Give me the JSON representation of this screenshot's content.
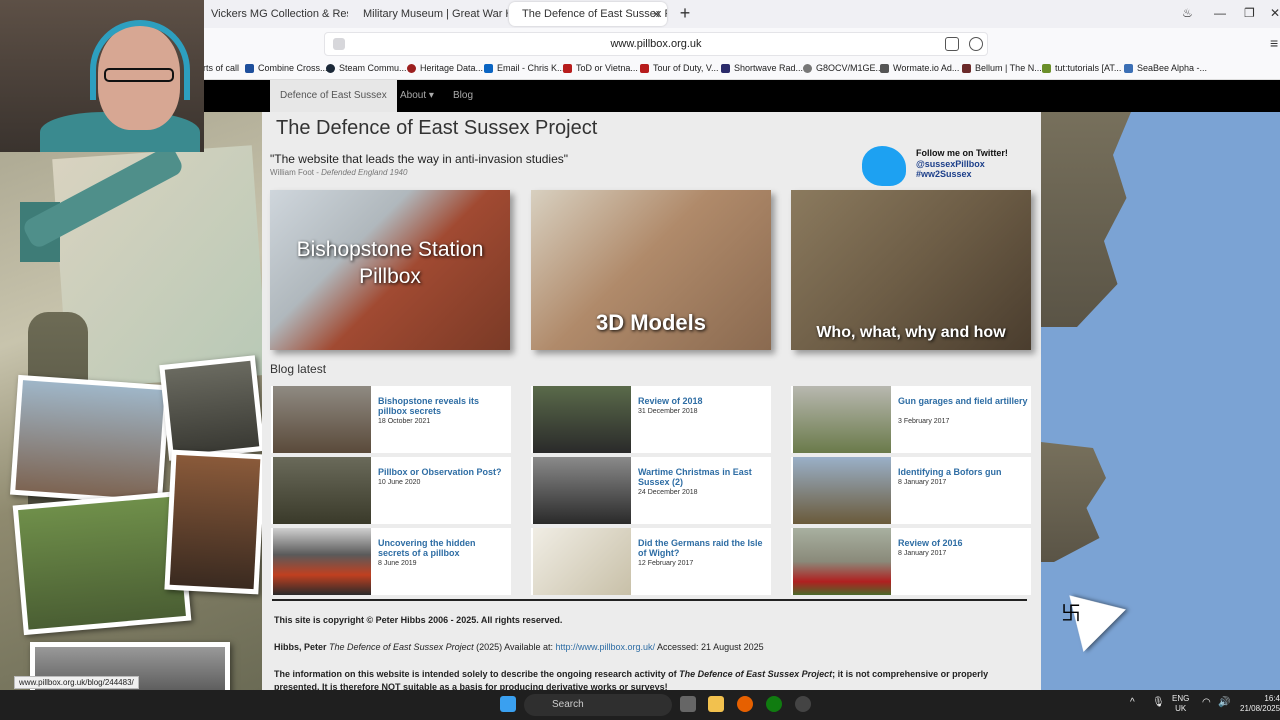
{
  "browser": {
    "tabs": [
      {
        "label": "Vickers MG Collection & Research"
      },
      {
        "label": "Military Museum | Great War Huts"
      },
      {
        "label": "The Defence of East Sussex Pr"
      }
    ],
    "url": "www.pillbox.org.uk",
    "bookmarks": [
      "rts of call",
      "Combine Cross...",
      "Steam Commu...",
      "Heritage Data...",
      "Email - Chris K...",
      "ToD or Vietna...",
      "Tour of Duty, V...",
      "Shortwave Rad...",
      "G8OCV/M1GE...",
      "Wormate.io Ad...",
      "Bellum | The N...",
      "tut:tutorials [AT...",
      "SeaBee Alpha -..."
    ]
  },
  "nav": {
    "home": "Defence of East Sussex",
    "about": "About ▾",
    "blog": "Blog"
  },
  "site": {
    "title": "The Defence of East Sussex Project",
    "quote": "\"The website that leads the way in anti-invasion studies\"",
    "attrib_name": "William Foot - ",
    "attrib_book": "Defended England 1940",
    "twitter": {
      "line1": "Follow me on Twitter!",
      "line2": "@sussexPillbox",
      "line3": "#ww2Sussex"
    }
  },
  "features": [
    {
      "label": "Bishopstone Station Pillbox"
    },
    {
      "label": "3D Models"
    },
    {
      "label": "Who, what, why and how"
    }
  ],
  "blog": {
    "heading": "Blog latest",
    "posts": [
      {
        "title": "Bishopstone reveals its pillbox secrets",
        "date": "18 October 2021"
      },
      {
        "title": "Review of 2018",
        "date": "31 December 2018"
      },
      {
        "title": "Gun garages and field artillery",
        "date": "3 February 2017"
      },
      {
        "title": "Pillbox or Observation Post?",
        "date": "10 June 2020"
      },
      {
        "title": "Wartime Christmas in East Sussex (2)",
        "date": "24 December 2018"
      },
      {
        "title": "Identifying a Bofors gun",
        "date": "8 January 2017"
      },
      {
        "title": "Uncovering the hidden secrets of a pillbox",
        "date": "8 June 2019"
      },
      {
        "title": "Did the Germans raid the Isle of Wight?",
        "date": "12 February 2017"
      },
      {
        "title": "Review of 2016",
        "date": "8 January 2017"
      }
    ]
  },
  "footer": {
    "copyright": "This site is copyright © Peter Hibbs 2006 - 2025. All rights reserved.",
    "cite_author": "Hibbs, Peter ",
    "cite_title": "The Defence of East Sussex Project",
    "cite_year": " (2025) Available at: ",
    "cite_link": "http://www.pillbox.org.uk/",
    "cite_accessed": " Accessed: 21 August 2025",
    "notice_a": "The information on this website is intended solely to describe the ongoing research activity of ",
    "notice_b": "The Defence of East Sussex Project",
    "notice_c": "; it is not comprehensive or properly presented. It is therefore NOT suitable as a basis for producing derivative works or surveys!"
  },
  "status_url": "www.pillbox.org.uk/blog/244483/",
  "taskbar": {
    "search": "Search",
    "lang1": "ENG",
    "lang2": "UK",
    "time": "16:4",
    "date": "21/08/2025"
  }
}
